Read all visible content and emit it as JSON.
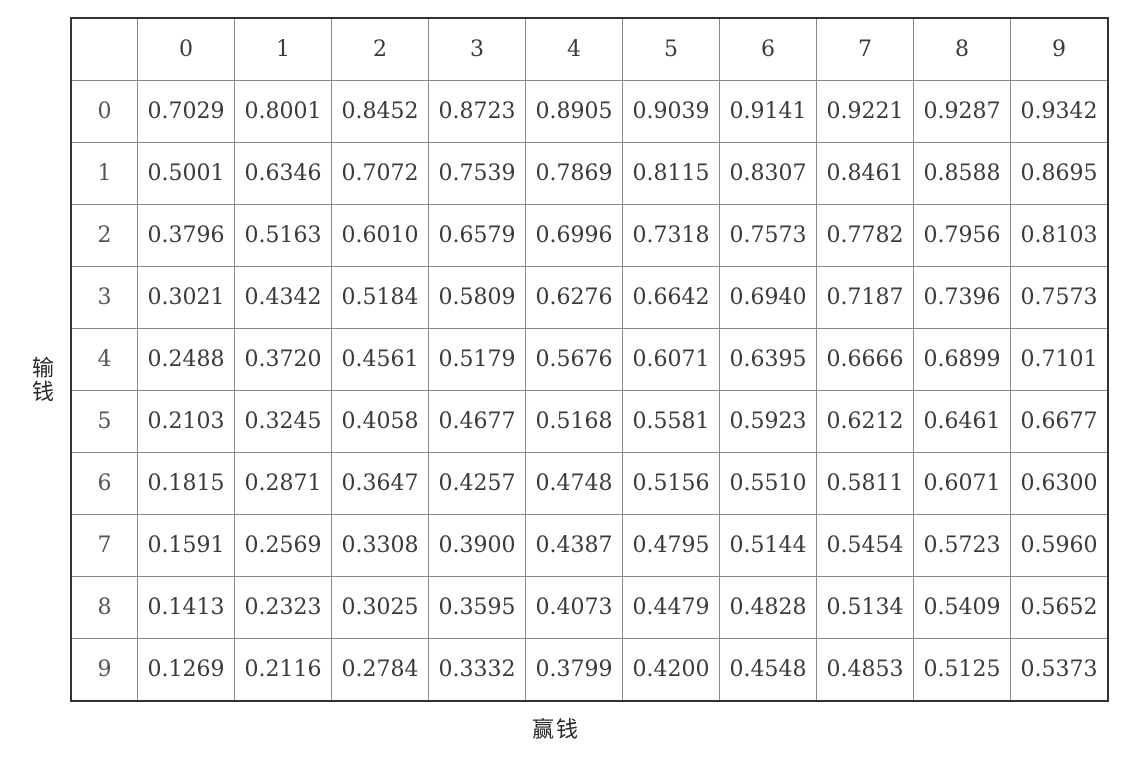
{
  "table": {
    "column_headers": [
      "0",
      "1",
      "2",
      "3",
      "4",
      "5",
      "6",
      "7",
      "8",
      "9"
    ],
    "rows": [
      {
        "label": "0",
        "values": [
          "0.7029",
          "0.8001",
          "0.8452",
          "0.8723",
          "0.8905",
          "0.9039",
          "0.9141",
          "0.9221",
          "0.9287",
          "0.9342"
        ]
      },
      {
        "label": "1",
        "values": [
          "0.5001",
          "0.6346",
          "0.7072",
          "0.7539",
          "0.7869",
          "0.8115",
          "0.8307",
          "0.8461",
          "0.8588",
          "0.8695"
        ]
      },
      {
        "label": "2",
        "values": [
          "0.3796",
          "0.5163",
          "0.6010",
          "0.6579",
          "0.6996",
          "0.7318",
          "0.7573",
          "0.7782",
          "0.7956",
          "0.8103"
        ]
      },
      {
        "label": "3",
        "values": [
          "0.3021",
          "0.4342",
          "0.5184",
          "0.5809",
          "0.6276",
          "0.6642",
          "0.6940",
          "0.7187",
          "0.7396",
          "0.7573"
        ]
      },
      {
        "label": "4",
        "values": [
          "0.2488",
          "0.3720",
          "0.4561",
          "0.5179",
          "0.5676",
          "0.6071",
          "0.6395",
          "0.6666",
          "0.6899",
          "0.7101"
        ]
      },
      {
        "label": "5",
        "values": [
          "0.2103",
          "0.3245",
          "0.4058",
          "0.4677",
          "0.5168",
          "0.5581",
          "0.5923",
          "0.6212",
          "0.6461",
          "0.6677"
        ]
      },
      {
        "label": "6",
        "values": [
          "0.1815",
          "0.2871",
          "0.3647",
          "0.4257",
          "0.4748",
          "0.5156",
          "0.5510",
          "0.5811",
          "0.6071",
          "0.6300"
        ]
      },
      {
        "label": "7",
        "values": [
          "0.1591",
          "0.2569",
          "0.3308",
          "0.3900",
          "0.4387",
          "0.4795",
          "0.5144",
          "0.5454",
          "0.5723",
          "0.5960"
        ]
      },
      {
        "label": "8",
        "values": [
          "0.1413",
          "0.2323",
          "0.3025",
          "0.3595",
          "0.4073",
          "0.4479",
          "0.4828",
          "0.5134",
          "0.5409",
          "0.5652"
        ]
      },
      {
        "label": "9",
        "values": [
          "0.1269",
          "0.2116",
          "0.2784",
          "0.3332",
          "0.3799",
          "0.4200",
          "0.4548",
          "0.4853",
          "0.5125",
          "0.5373"
        ]
      }
    ]
  },
  "axis_labels": {
    "x": "赢钱",
    "y": "输钱"
  }
}
